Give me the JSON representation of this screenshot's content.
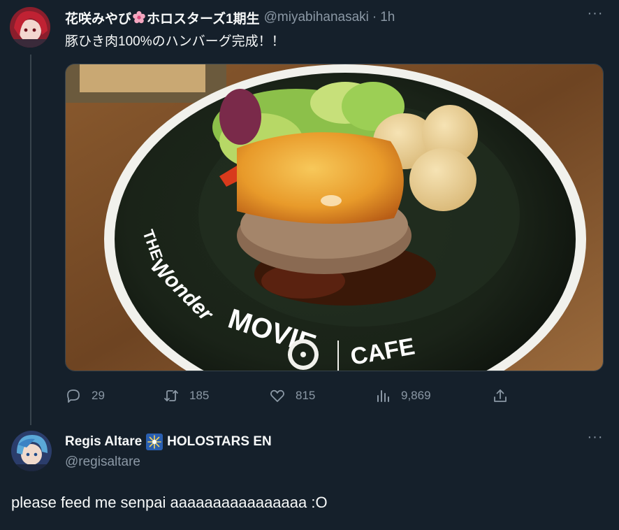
{
  "tweet": {
    "author_name_prefix": "花咲みやび",
    "author_name_suffix": "ホロスターズ1期生",
    "author_handle": "@miyabihanasaki",
    "separator": "·",
    "time": "1h",
    "text": "豚ひき肉100%のハンバーグ完成！！",
    "image": {
      "plate_text_the": "THE",
      "plate_text_wonder": "Wonder",
      "plate_text_movie": "MOVIE",
      "plate_text_cafe": "CAFE"
    },
    "stats": {
      "replies": "29",
      "retweets": "185",
      "likes": "815",
      "views": "9,869"
    }
  },
  "reply": {
    "author_name": "Regis Altare",
    "author_affiliation": "HOLOSTARS EN",
    "author_handle": "@regisaltare",
    "text": "please feed me senpai aaaaaaaaaaaaaaaa :O"
  },
  "colors": {
    "background": "#15202b",
    "text_primary": "#f7f9f9",
    "text_secondary": "#8b98a5",
    "divider": "#38444d"
  },
  "icons": {
    "reply": "reply-icon",
    "retweet": "retweet-icon",
    "like": "heart-icon",
    "views": "views-icon",
    "share": "share-icon",
    "more": "more-icon"
  }
}
